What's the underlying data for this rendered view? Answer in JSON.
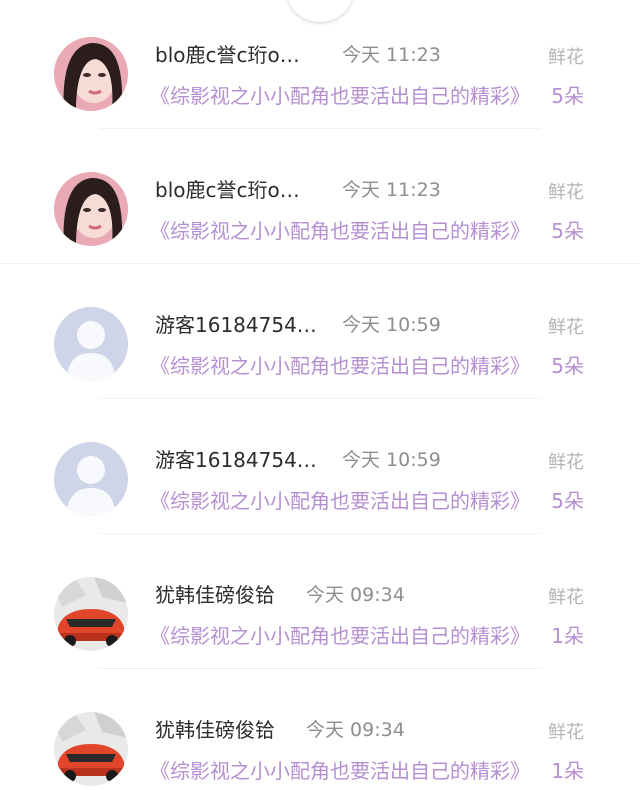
{
  "records": [
    {
      "avatar": "woman-portrait",
      "name": "blo鹿c誉c珩o…",
      "time": "今天 11:23",
      "type": "鲜花",
      "book": "《综影视之小小配角也要活出自己的精彩》",
      "qty": "5朵"
    },
    {
      "avatar": "woman-portrait",
      "name": "blo鹿c誉c珩o…",
      "time": "今天 11:23",
      "type": "鲜花",
      "book": "《综影视之小小配角也要活出自己的精彩》",
      "qty": "5朵"
    },
    {
      "avatar": "default-user",
      "name": "游客16184754…",
      "time": "今天 10:59",
      "type": "鲜花",
      "book": "《综影视之小小配角也要活出自己的精彩》",
      "qty": "5朵"
    },
    {
      "avatar": "default-user",
      "name": "游客16184754…",
      "time": "今天 10:59",
      "type": "鲜花",
      "book": "《综影视之小小配角也要活出自己的精彩》",
      "qty": "5朵"
    },
    {
      "avatar": "red-sports-car",
      "name": "犹韩佳磅俊铪",
      "time": "今天 09:34",
      "type": "鲜花",
      "book": "《综影视之小小配角也要活出自己的精彩》",
      "qty": "1朵"
    },
    {
      "avatar": "red-sports-car",
      "name": "犹韩佳磅俊铪",
      "time": "今天 09:34",
      "type": "鲜花",
      "book": "《综影视之小小配角也要活出自己的精彩》",
      "qty": "1朵"
    }
  ],
  "colors": {
    "name_text": "#2c2c2c",
    "time_text": "#8e8e8e",
    "type_text": "#b4b4b4",
    "accent_purple": "#b68fd2",
    "default_avatar_bg": "#cfd5e8"
  }
}
